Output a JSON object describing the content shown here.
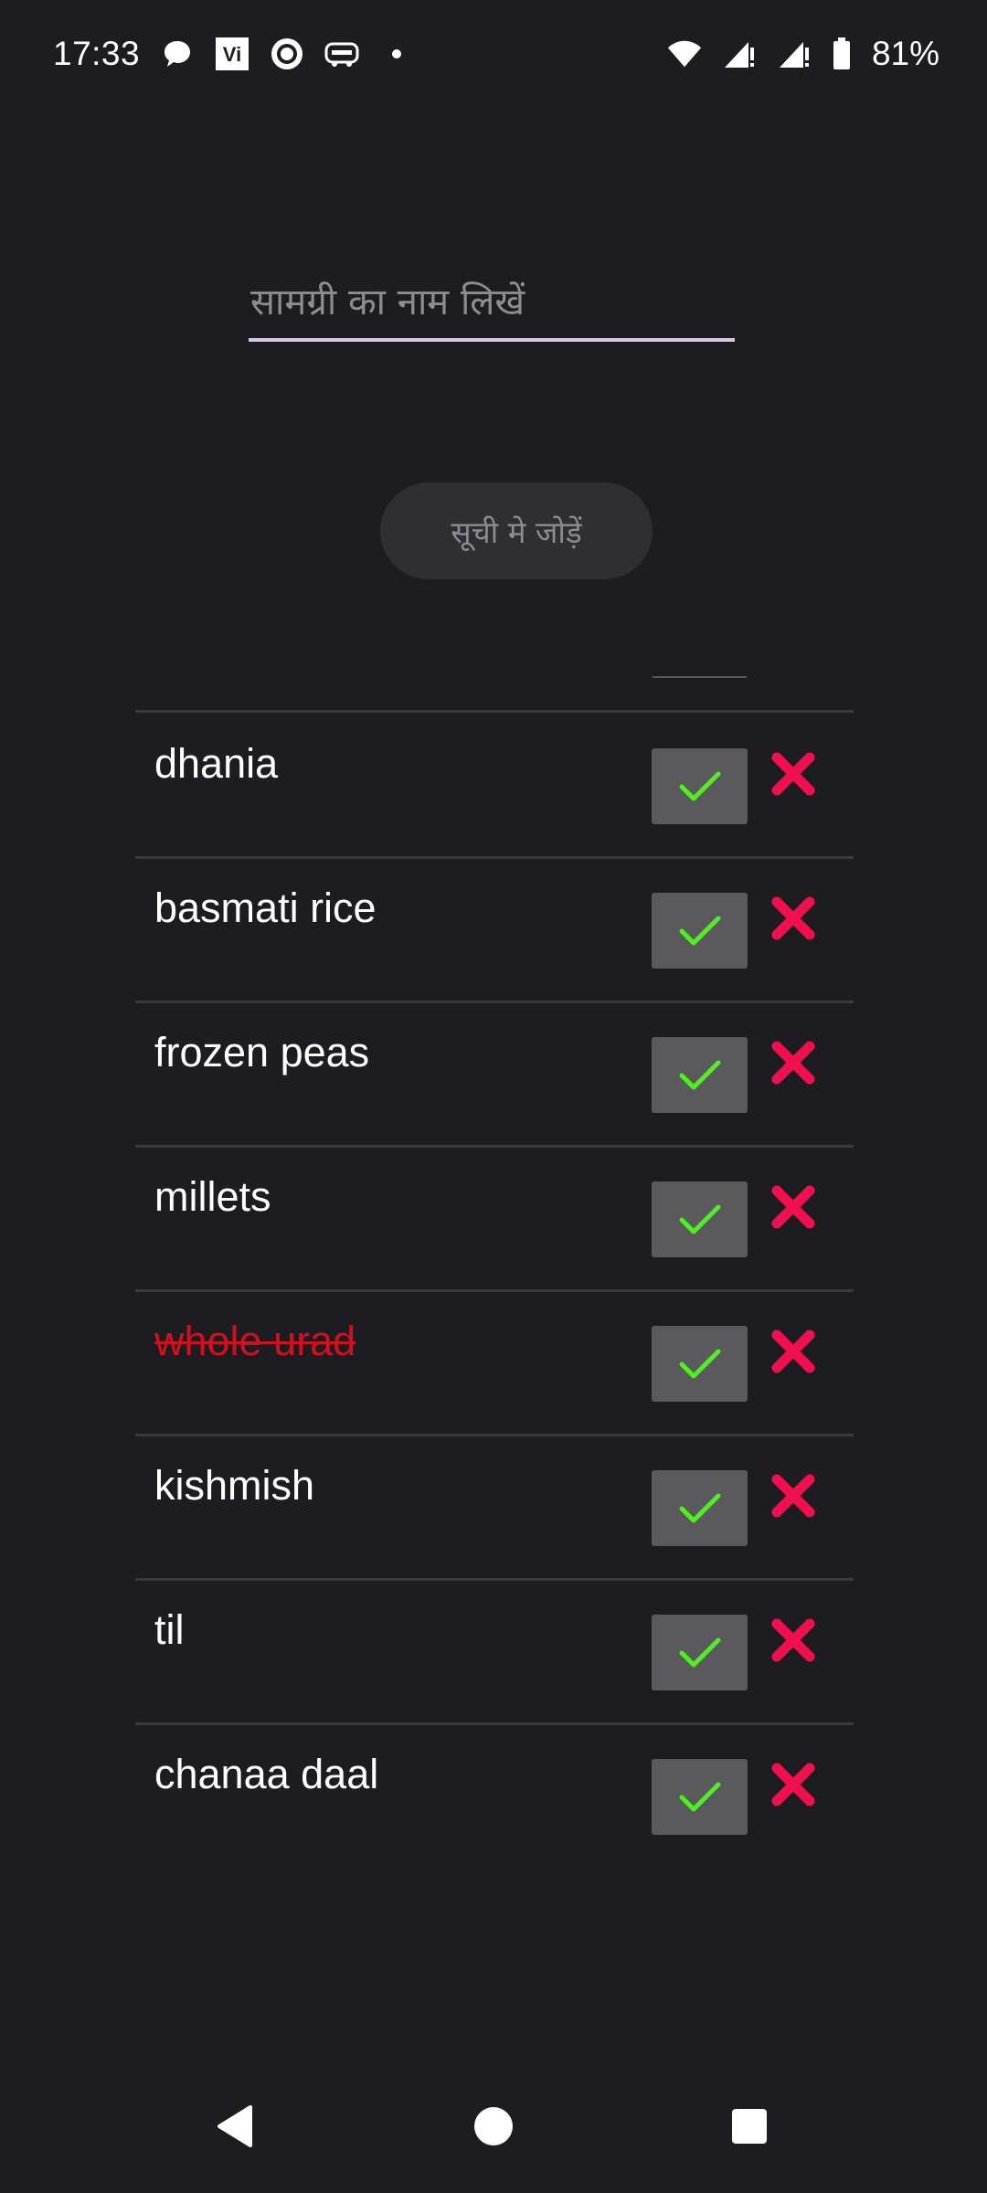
{
  "status_bar": {
    "time": "17:33",
    "battery": "81%",
    "notification_icons": [
      "chat-bubble-icon",
      "vi-app-icon",
      "circle-record-icon",
      "redbus-icon",
      "dot-icon"
    ],
    "system_icons": [
      "wifi-icon",
      "signal-icon",
      "signal-icon",
      "battery-icon"
    ]
  },
  "input": {
    "placeholder": "सामग्री का नाम लिखें",
    "value": ""
  },
  "add_button": {
    "label": "सूची मे जोड़ें"
  },
  "items": [
    {
      "name": "dhania",
      "done": false
    },
    {
      "name": "basmati rice",
      "done": false
    },
    {
      "name": "frozen peas",
      "done": false
    },
    {
      "name": "millets",
      "done": false
    },
    {
      "name": "whole urad",
      "done": true
    },
    {
      "name": "kishmish",
      "done": false
    },
    {
      "name": "til",
      "done": false
    },
    {
      "name": "chanaa daal",
      "done": false
    }
  ],
  "colors": {
    "background": "#1d1c21",
    "check_bg": "#5a5a5c",
    "check_mark": "#4ef01e",
    "delete_mark": "#f0104e",
    "struck_text": "#d0101e",
    "input_underline": "#d8c6e8"
  },
  "nav": {
    "icons": [
      "back-icon",
      "home-icon",
      "recents-icon"
    ]
  }
}
